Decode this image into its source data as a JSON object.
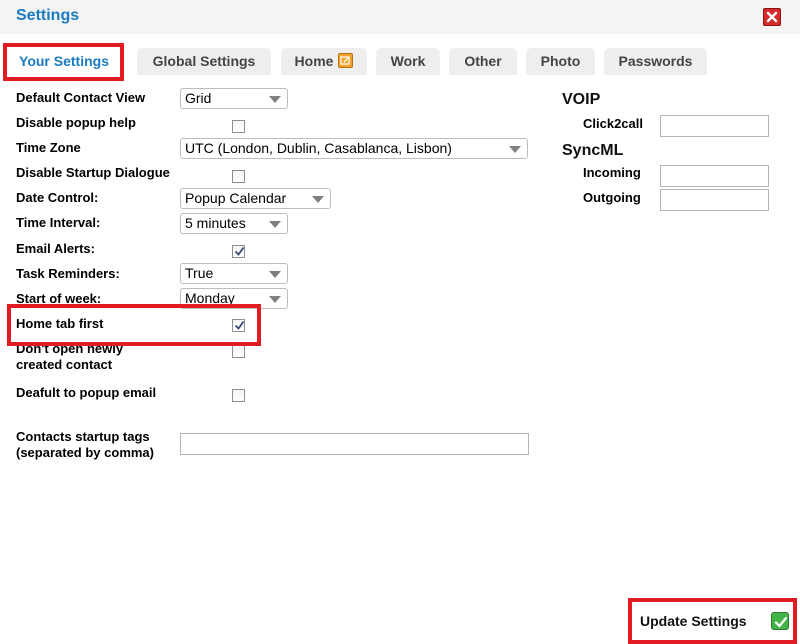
{
  "window": {
    "title": "Settings"
  },
  "tabs": [
    {
      "label": "Your Settings"
    },
    {
      "label": "Global Settings"
    },
    {
      "label": "Home"
    },
    {
      "label": "Work"
    },
    {
      "label": "Other"
    },
    {
      "label": "Photo"
    },
    {
      "label": "Passwords"
    }
  ],
  "settings": {
    "default_contact_view": {
      "label": "Default Contact View",
      "value": "Grid"
    },
    "disable_popup_help": {
      "label": "Disable popup help",
      "checked": false
    },
    "time_zone": {
      "label": "Time Zone",
      "value": "UTC (London, Dublin, Casablanca, Lisbon)"
    },
    "disable_startup_dialogue": {
      "label": "Disable Startup Dialogue",
      "checked": false
    },
    "date_control": {
      "label": "Date Control:",
      "value": "Popup Calendar"
    },
    "time_interval": {
      "label": "Time Interval:",
      "value": "5 minutes"
    },
    "email_alerts": {
      "label": "Email Alerts:",
      "checked": true
    },
    "task_reminders": {
      "label": "Task Reminders:",
      "value": "True"
    },
    "start_of_week": {
      "label": "Start of week:",
      "value": "Monday"
    },
    "home_tab_first": {
      "label": "Home tab first",
      "checked": true
    },
    "dont_open_new_contact": {
      "label_line1": "Don't open newly",
      "label_line2": "created contact",
      "checked": false
    },
    "default_popup_email": {
      "label": "Deafult to popup email",
      "checked": false
    },
    "contacts_startup_tags": {
      "label_line1": "Contacts startup tags",
      "label_line2": "(separated by comma)",
      "value": ""
    }
  },
  "voip": {
    "heading": "VOIP",
    "click2call": {
      "label": "Click2call",
      "value": ""
    }
  },
  "syncml": {
    "heading": "SyncML",
    "incoming": {
      "label": "Incoming",
      "value": ""
    },
    "outgoing": {
      "label": "Outgoing",
      "value": ""
    }
  },
  "footer": {
    "update_label": "Update Settings"
  },
  "colors": {
    "accent": "#1a7bbf",
    "highlight": "#e31b23",
    "tab_bg": "#eeeeee"
  },
  "icons": {
    "close": "close-icon",
    "home_tab": "edit-icon",
    "update": "check-icon"
  }
}
